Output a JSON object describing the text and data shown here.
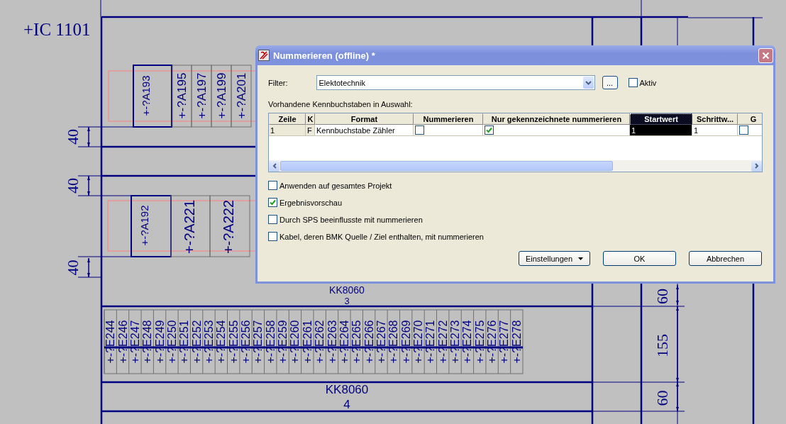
{
  "drawing": {
    "location": "+IC 1101",
    "group_1": {
      "main_device": "+-?A193",
      "devices": [
        "+-?A195",
        "+-?A197",
        "+-?A199",
        "+-?A201"
      ]
    },
    "group_2": {
      "main_device": "+-?A192",
      "devices": [
        "+-?A221",
        "+-?A222"
      ]
    },
    "left_dimensions": [
      "40",
      "40",
      "40"
    ],
    "rail_3": {
      "name": "KK8060",
      "number": "3"
    },
    "terminals": [
      "+-?E244",
      "+-?E246",
      "+-?E247",
      "+-?E248",
      "+-?E249",
      "+-?E250",
      "+-?E251",
      "+-?E252",
      "+-?E253",
      "+-?E254",
      "+-?E255",
      "+-?E256",
      "+-?E257",
      "+-?E258",
      "+-?E259",
      "+-?E260",
      "+-?E261",
      "+-?E262",
      "+-?E263",
      "+-?E264",
      "+-?E265",
      "+-?E266",
      "+-?E267",
      "+-?E268",
      "+-?E269",
      "+-?E270",
      "+-?E271",
      "+-?E272",
      "+-?E273",
      "+-?E274",
      "+-?E275",
      "+-?E276",
      "+-?E277",
      "+-?E278"
    ],
    "rail_4": {
      "name": "KK8060",
      "number": "4"
    },
    "right_dimensions": [
      "60",
      "155",
      "60"
    ]
  },
  "dialog": {
    "title": "Nummerieren (offline) *",
    "filter": {
      "label": "Filter:",
      "value": "Elektotechnik",
      "browse": "...",
      "active": {
        "label": "Aktiv",
        "checked": false
      }
    },
    "table": {
      "caption": "Vorhandene Kennbuchstaben in Auswahl:",
      "columns": [
        {
          "label": "Zeile",
          "selected": false
        },
        {
          "label": "K",
          "selected": false
        },
        {
          "label": "Format",
          "selected": false
        },
        {
          "label": "Nummerieren",
          "selected": false
        },
        {
          "label": "Nur gekennzeichnete nummerieren",
          "selected": false
        },
        {
          "label": "Startwert",
          "selected": true
        },
        {
          "label": "Schrittw...",
          "selected": false
        },
        {
          "label": "G",
          "selected": false
        }
      ],
      "rows": [
        {
          "cells": [
            {
              "kind": "text",
              "text": "1",
              "selected": false
            },
            {
              "kind": "text",
              "text": "F",
              "selected": false
            },
            {
              "kind": "text",
              "text": "Kennbuchstabe Zähler",
              "selected": false
            },
            {
              "kind": "check",
              "checked": false
            },
            {
              "kind": "check",
              "checked": true
            },
            {
              "kind": "text",
              "text": "1",
              "selected": true
            },
            {
              "kind": "text",
              "text": "1",
              "selected": false
            },
            {
              "kind": "check",
              "checked": false
            }
          ]
        }
      ]
    },
    "options": [
      {
        "label": "Anwenden auf gesamtes Projekt",
        "checked": false
      },
      {
        "label": "Ergebnisvorschau",
        "checked": true
      },
      {
        "label": "Durch SPS beeinflusste mit nummerieren",
        "checked": false
      },
      {
        "label": "Kabel, deren BMK Quelle / Ziel enthalten, mit nummerieren",
        "checked": false
      }
    ],
    "buttons": [
      {
        "label": "Einstellungen",
        "kind": "menu"
      },
      {
        "label": "OK",
        "kind": "plain"
      },
      {
        "label": "Abbrechen",
        "kind": "plain"
      }
    ]
  }
}
